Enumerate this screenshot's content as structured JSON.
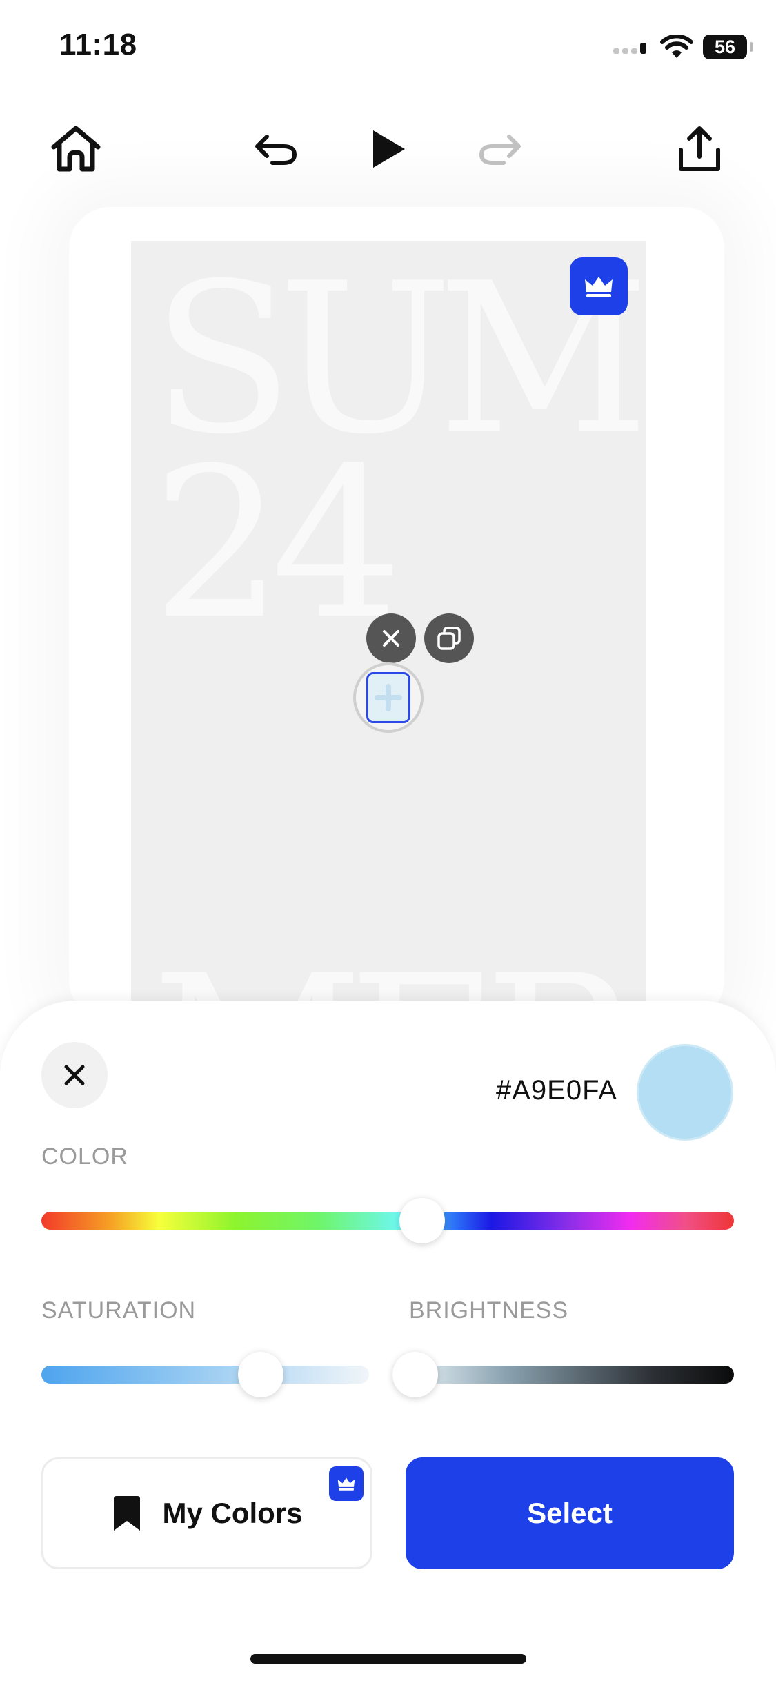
{
  "status_bar": {
    "time": "11:18",
    "battery": "56",
    "icons": [
      "cellular-icon",
      "wifi-icon",
      "battery-icon"
    ]
  },
  "toolbar": {
    "icons": [
      "home-icon",
      "undo-icon",
      "play-icon",
      "redo-icon",
      "share-icon"
    ]
  },
  "canvas": {
    "lines": [
      "SUM",
      "24",
      "MER"
    ],
    "badge_icon": "crown-icon",
    "selection_actions": [
      "delete-icon",
      "duplicate-icon"
    ]
  },
  "picker": {
    "hex": "#A9E0FA",
    "swatch_color": "#b4def4",
    "color_label": "COLOR",
    "saturation_label": "SATURATION",
    "brightness_label": "BRIGHTNESS",
    "hue": 0.55,
    "saturation": 0.67,
    "brightness": 0.02,
    "my_colors_label": "My Colors",
    "select_label": "Select"
  },
  "colors": {
    "accent": "#1d40e8",
    "canvas_bg": "#efefef"
  }
}
